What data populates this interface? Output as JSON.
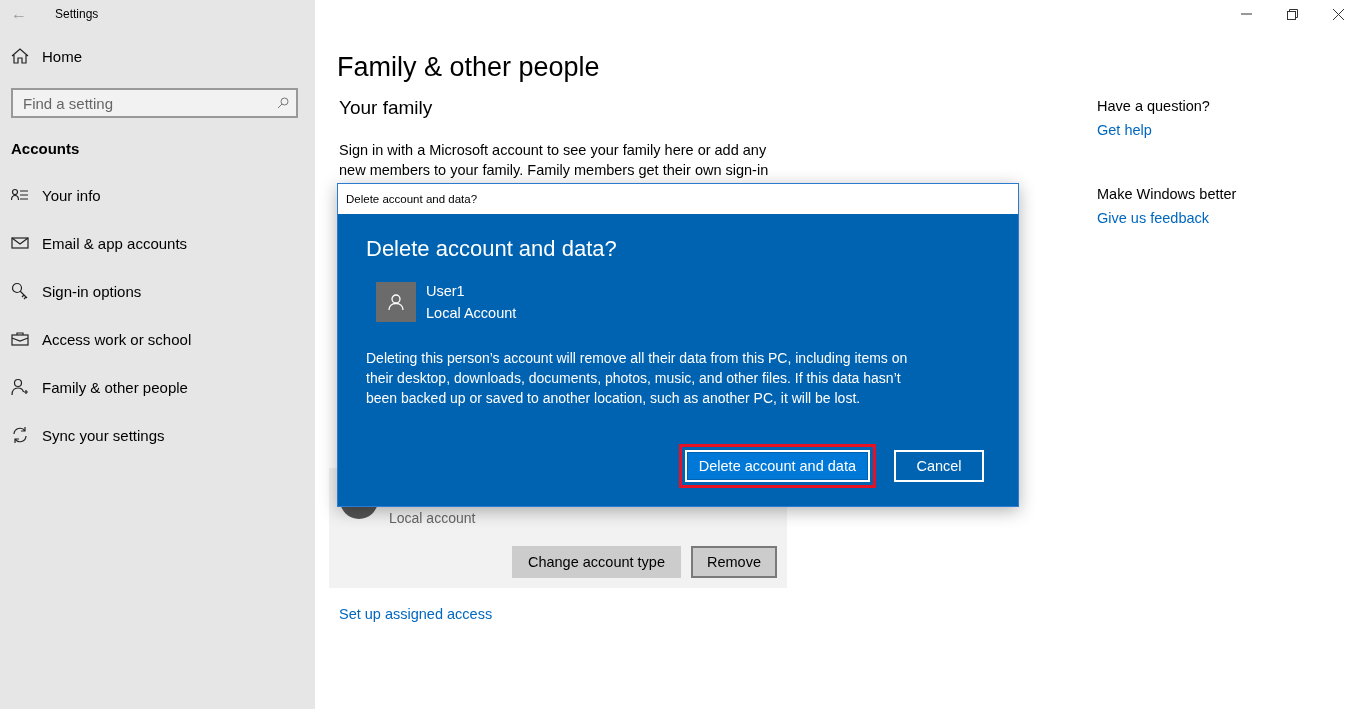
{
  "window": {
    "title": "Settings",
    "back": "←",
    "controls": [
      {
        "kind": "minimize"
      },
      {
        "kind": "restore"
      },
      {
        "kind": "close"
      }
    ]
  },
  "sidebar": {
    "home": "Home",
    "search": {
      "placeholder": "Find a setting"
    },
    "section": "Accounts",
    "items": [
      {
        "label": "Your info",
        "kind": "info"
      },
      {
        "label": "Email & app accounts",
        "kind": "mail"
      },
      {
        "label": "Sign-in options",
        "kind": "key"
      },
      {
        "label": "Access work or school",
        "kind": "briefcase"
      },
      {
        "label": "Family & other people",
        "kind": "person-add"
      },
      {
        "label": "Sync your settings",
        "kind": "sync"
      }
    ]
  },
  "main": {
    "title": "Family & other people",
    "family_heading": "Your family",
    "family_text": [
      "Sign in with a Microsoft account to see your family here or add any",
      "new members to your family. Family members get their own sign-in"
    ],
    "account_card": {
      "account_type": "Local account",
      "buttons": [
        {
          "label": "Change account type",
          "outlined": false
        },
        {
          "label": "Remove",
          "outlined": true
        }
      ]
    },
    "link": "Set up assigned access"
  },
  "aside": [
    {
      "heading": "Have a question?",
      "link": "Get help"
    },
    {
      "heading": "Make Windows better",
      "link": "Give us feedback"
    }
  ],
  "dialog": {
    "title": "Delete account and data?",
    "heading": "Delete account and data?",
    "user_name": "User1",
    "account_type": "Local Account",
    "message": "Deleting this person’s account will remove all their data from this PC, including items on their desktop, downloads, documents, photos, music, and other files. If this data hasn’t been backed up or saved to another location, such as another PC, it will be lost.",
    "buttons": [
      {
        "label": "Delete account and data",
        "primary": true,
        "highlighted": true
      },
      {
        "label": "Cancel",
        "primary": false,
        "highlighted": false
      }
    ]
  }
}
